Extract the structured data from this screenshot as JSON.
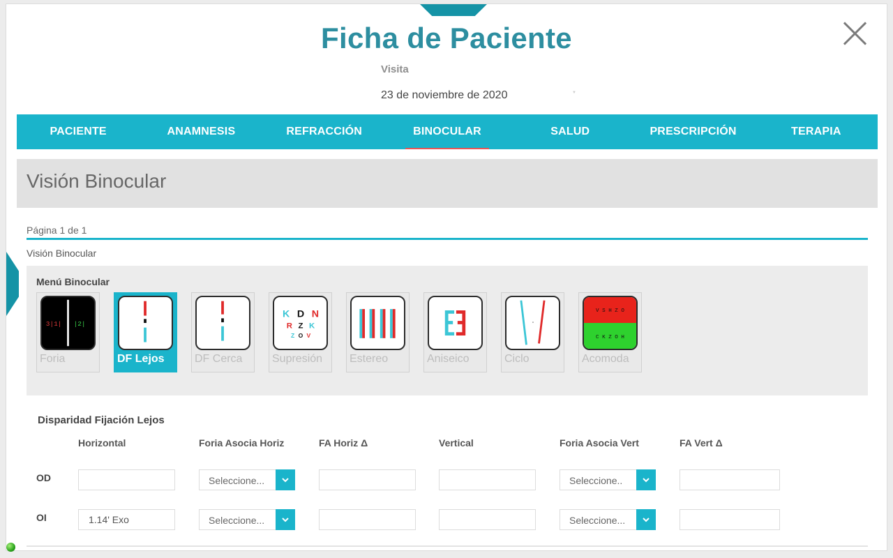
{
  "header": {
    "title": "Ficha de Paciente",
    "visit_label": "Visita",
    "visit_date": "23 de noviembre de 2020"
  },
  "tabs": [
    {
      "label": "PACIENTE"
    },
    {
      "label": "ANAMNESIS"
    },
    {
      "label": "REFRACCIÓN"
    },
    {
      "label": "BINOCULAR",
      "active": true
    },
    {
      "label": "SALUD"
    },
    {
      "label": "PRESCRIPCIÓN"
    },
    {
      "label": "TERAPIA"
    }
  ],
  "section": {
    "title": "Visión Binocular",
    "page_info": "Página 1 de 1",
    "breadcrumb": "Visión Binocular"
  },
  "menu": {
    "title": "Menú Binocular",
    "items": [
      {
        "label": "Foria",
        "icon": "foria-chart-icon",
        "chart_text_left": "3|1|",
        "chart_text_right": "|2|"
      },
      {
        "label": "DF Lejos",
        "icon": "df-lejos-chart-icon",
        "active": true
      },
      {
        "label": "DF Cerca",
        "icon": "df-cerca-chart-icon"
      },
      {
        "label": "Supresión",
        "icon": "supresion-chart-icon",
        "letters": [
          "K",
          "D",
          "N",
          "R",
          "Z",
          "K",
          "Z",
          "O",
          "V"
        ]
      },
      {
        "label": "Estereo",
        "icon": "estereo-chart-icon"
      },
      {
        "label": "Aniseico",
        "icon": "aniseico-chart-icon"
      },
      {
        "label": "Ciclo",
        "icon": "ciclo-chart-icon"
      },
      {
        "label": "Acomoda",
        "icon": "acomoda-chart-icon",
        "top_letters": "V S H Z O",
        "bottom_letters": "C K Z O H"
      }
    ]
  },
  "form": {
    "title": "Disparidad Fijación Lejos",
    "columns": [
      "Horizontal",
      "Foria Asocia Horiz",
      "FA Horiz Δ",
      "Vertical",
      "Foria Asocia Vert",
      "FA Vert Δ"
    ],
    "rows": [
      {
        "label": "OD",
        "horizontal": "",
        "foria_horiz": "Seleccione...",
        "fa_horiz": "",
        "vertical": "",
        "foria_vert": "Seleccione..",
        "fa_vert": ""
      },
      {
        "label": "OI",
        "horizontal": "1.14' Exo",
        "foria_horiz": "Seleccione...",
        "fa_horiz": "",
        "vertical": "",
        "foria_vert": "Seleccione...",
        "fa_vert": ""
      }
    ]
  },
  "colors": {
    "accent": "#1ab4cb",
    "title": "#2d8ea0",
    "active_underline": "#e75555"
  }
}
